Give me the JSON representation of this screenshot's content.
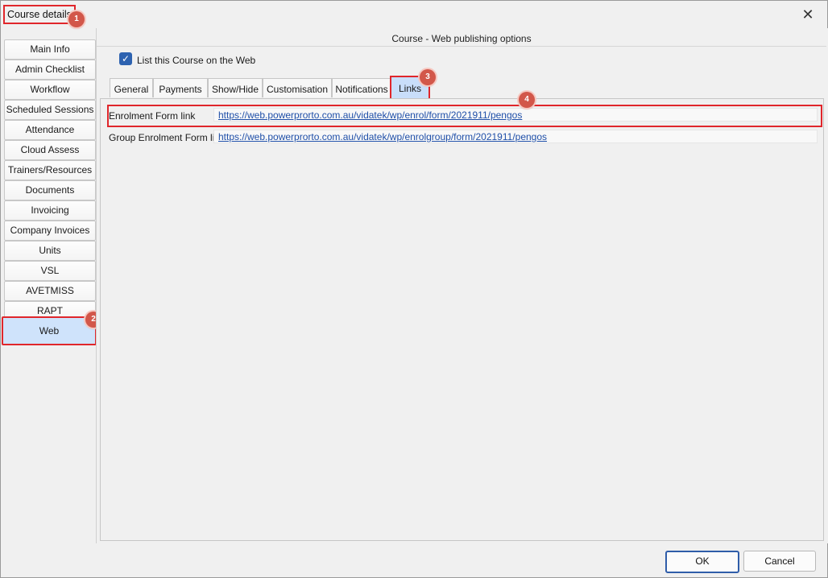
{
  "window": {
    "title": "Course details",
    "close_glyph": "✕"
  },
  "badges": [
    "1",
    "2",
    "3",
    "4"
  ],
  "sidebar": {
    "items": [
      {
        "label": "Main Info"
      },
      {
        "label": "Admin Checklist"
      },
      {
        "label": "Workflow"
      },
      {
        "label": "Scheduled Sessions"
      },
      {
        "label": "Attendance"
      },
      {
        "label": "Cloud Assess"
      },
      {
        "label": "Trainers/Resources"
      },
      {
        "label": "Documents"
      },
      {
        "label": "Invoicing"
      },
      {
        "label": "Company Invoices"
      },
      {
        "label": "Units"
      },
      {
        "label": "VSL"
      },
      {
        "label": "AVETMISS"
      },
      {
        "label": "RAPT"
      },
      {
        "label": "Web",
        "active": true
      }
    ]
  },
  "panel": {
    "header": "Course - Web publishing options",
    "list_checkbox": {
      "label": "List this Course on the Web",
      "checked": true
    },
    "tabs": [
      {
        "label": "General"
      },
      {
        "label": "Payments"
      },
      {
        "label": "Show/Hide"
      },
      {
        "label": "Customisation"
      },
      {
        "label": "Notifications"
      },
      {
        "label": "Links",
        "active": true
      }
    ],
    "links": {
      "enrolment_label": "Enrolment Form link",
      "enrolment_url": "https://web.powerprorto.com.au/vidatek/wp/enrol/form/2021911/pengos",
      "group_label": "Group Enrolment Form link",
      "group_url": "https://web.powerprorto.com.au/vidatek/wp/enrolgroup/form/2021911/pengos"
    }
  },
  "footer": {
    "ok": "OK",
    "cancel": "Cancel"
  },
  "colors": {
    "highlight": "#e0262b",
    "badge": "#d2574a",
    "active_tab": "#c9defa",
    "link": "#1f4fa8"
  }
}
